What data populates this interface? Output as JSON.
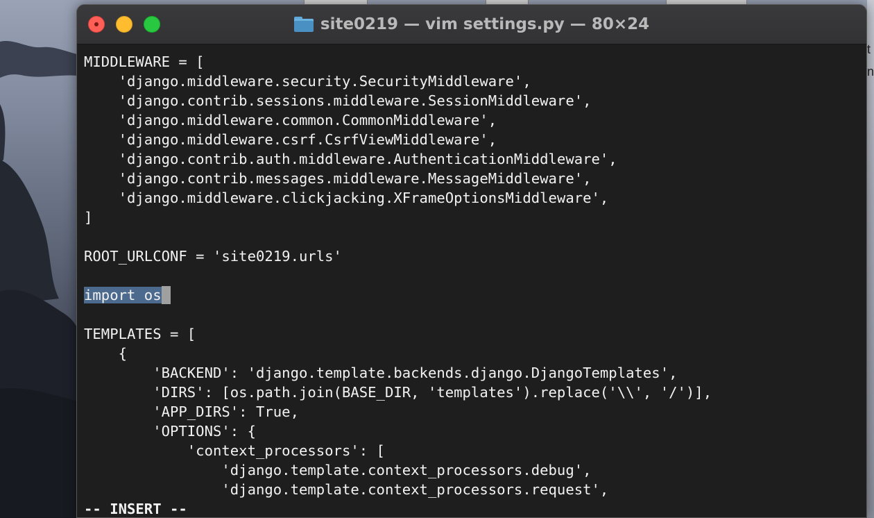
{
  "window": {
    "title": "site0219 — vim settings.py — 80×24",
    "folder_icon": "folder-icon",
    "traffic_lights": {
      "close_color": "#ff5f57",
      "minimize_color": "#febc2e",
      "maximize_color": "#28c840"
    }
  },
  "editor": {
    "selection_color": "#4c6a8e",
    "cursor_color": "#a0a0a0",
    "lines": [
      "MIDDLEWARE = [",
      "    'django.middleware.security.SecurityMiddleware',",
      "    'django.contrib.sessions.middleware.SessionMiddleware',",
      "    'django.middleware.common.CommonMiddleware',",
      "    'django.middleware.csrf.CsrfViewMiddleware',",
      "    'django.contrib.auth.middleware.AuthenticationMiddleware',",
      "    'django.contrib.messages.middleware.MessageMiddleware',",
      "    'django.middleware.clickjacking.XFrameOptionsMiddleware',",
      "]",
      "",
      "ROOT_URLCONF = 'site0219.urls'",
      "",
      "import os",
      "",
      "TEMPLATES = [",
      "    {",
      "        'BACKEND': 'django.template.backends.django.DjangoTemplates',",
      "        'DIRS': [os.path.join(BASE_DIR, 'templates').replace('\\\\', '/')],",
      "        'APP_DIRS': True,",
      "        'OPTIONS': {",
      "            'context_processors': [",
      "                'django.template.context_processors.debug',",
      "                'django.template.context_processors.request',"
    ],
    "mode": "-- INSERT --"
  },
  "background_text": {
    "right_edge_chars": [
      "t",
      "n"
    ]
  }
}
